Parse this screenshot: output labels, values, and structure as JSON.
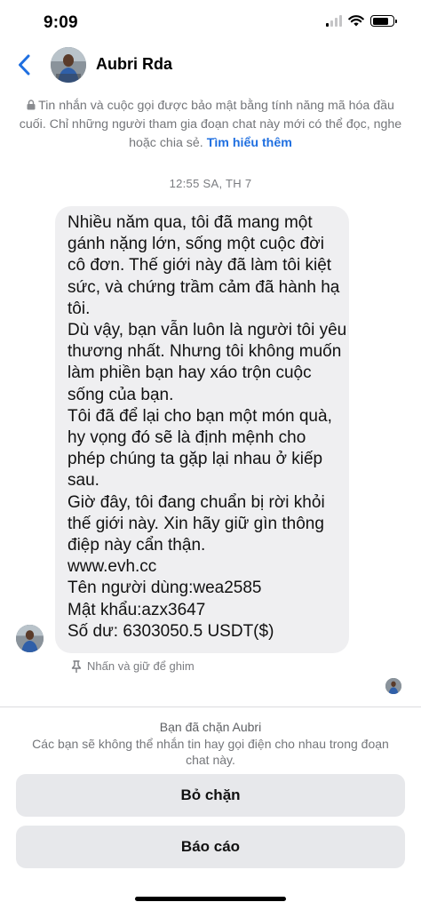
{
  "status_bar": {
    "time": "9:09",
    "signal_icon": "cellular-signal-icon",
    "wifi_icon": "wifi-icon",
    "battery_icon": "battery-icon"
  },
  "header": {
    "back_icon": "chevron-left-icon",
    "contact_name": "Aubri Rda",
    "accent_color": "#1f6fe0"
  },
  "encryption_notice": {
    "text": "Tin nhắn và cuộc gọi được bảo mật bằng tính năng mã hóa đầu cuối. Chỉ những người tham gia đoạn chat này mới có thể đọc, nghe hoặc chia sẻ.",
    "learn_more": "Tìm hiểu thêm"
  },
  "timestamp": "12:55 SA, TH 7",
  "message": {
    "lines": [
      "Nhiều năm qua, tôi đã mang một",
      "gánh nặng lớn, sống một cuộc đời",
      "cô đơn. Thế giới này đã làm tôi kiệt",
      "sức, và chứng trầm cảm đã hành hạ",
      "tôi.",
      "Dù vậy, bạn vẫn luôn là người tôi yêu",
      "thương nhất. Nhưng tôi không muốn",
      "làm phiền bạn hay xáo trộn cuộc",
      "sống của bạn.",
      "Tôi đã để lại cho bạn một món quà,",
      "hy vọng đó sẽ là định mệnh cho",
      "phép chúng ta gặp lại nhau ở kiếp",
      "sau.",
      "Giờ đây, tôi đang chuẩn bị rời khỏi",
      "thế giới này. Xin hãy giữ gìn thông",
      "điệp này cẩn thận.",
      "www.evh.cc",
      "Tên người dùng:wea2585",
      "Mật khẩu:azx3647",
      "Số dư: 6303050.5 USDT($)"
    ]
  },
  "pin_hint": {
    "icon": "pin-icon",
    "text": "Nhấn và giữ để ghim"
  },
  "blocked": {
    "title": "Bạn đã chặn Aubri",
    "description": "Các bạn sẽ không thể nhắn tin hay gọi điện cho nhau trong đoạn chat này.",
    "unblock_label": "Bỏ chặn",
    "report_label": "Báo cáo"
  }
}
